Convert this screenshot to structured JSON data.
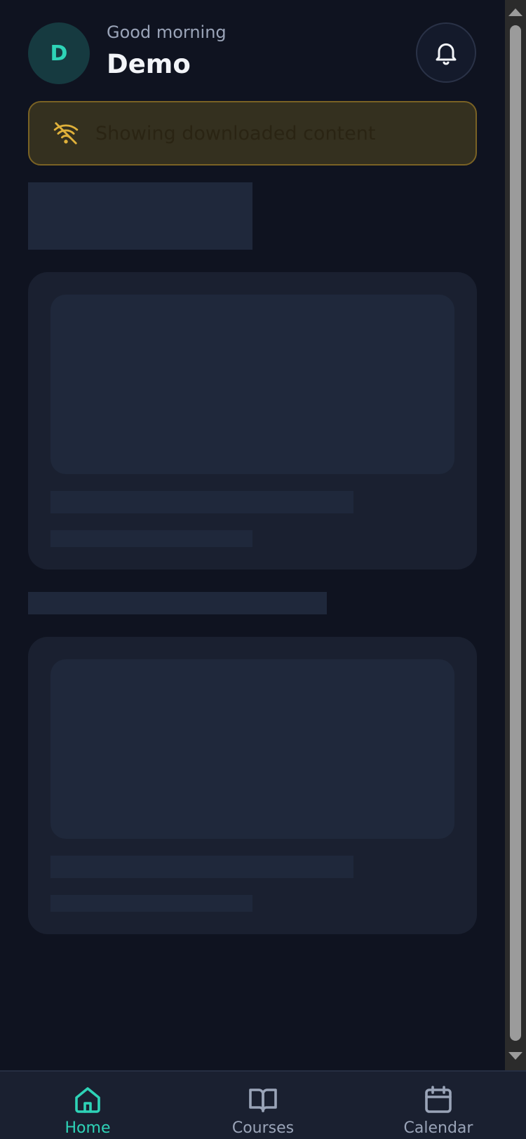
{
  "header": {
    "avatar_initial": "D",
    "greeting": "Good morning",
    "username": "Demo",
    "notifications_icon": "bell-icon"
  },
  "banner": {
    "icon": "wifi-off-icon",
    "text": "Showing downloaded content"
  },
  "bottom_nav": {
    "items": [
      {
        "label": "Home",
        "icon": "home-icon",
        "active": true
      },
      {
        "label": "Courses",
        "icon": "book-open-icon",
        "active": false
      },
      {
        "label": "Calendar",
        "icon": "calendar-icon",
        "active": false
      }
    ]
  },
  "colors": {
    "background": "#0f1320",
    "accent": "#2ed3b7",
    "card": "#1a2030",
    "skeleton": "#1f283b",
    "warning_border": "#7a6224",
    "warning_icon": "#e0b13a"
  }
}
